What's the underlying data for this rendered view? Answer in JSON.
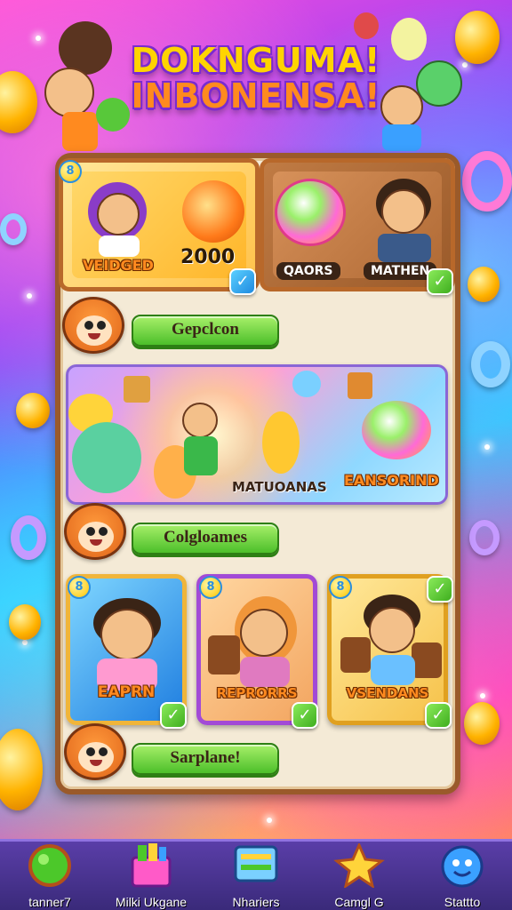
{
  "game": {
    "title_line1": "DOKNGUMA!",
    "title_line2": "INBONENSA!"
  },
  "top_cards": [
    {
      "badge": "8",
      "label": "VEIDGED",
      "value": "2000",
      "check": "✓"
    },
    {
      "label_left": "QAORS",
      "label_right": "MATHEN",
      "check": "✓"
    }
  ],
  "buttons": {
    "first": "Gepclcon",
    "second": "Colgloames",
    "third": "Sarplane!"
  },
  "banner": {
    "label_left": "MATUOANAS",
    "label_right": "EANSORIND"
  },
  "character_cards": [
    {
      "badge": "8",
      "label": "EAPRN",
      "check": "✓"
    },
    {
      "badge": "8",
      "label": "REPRORRS",
      "check": "✓"
    },
    {
      "badge": "8",
      "label": "VSENDANS",
      "check": "✓"
    }
  ],
  "nav": [
    {
      "label": "tanner7",
      "icon": "green-medal-icon"
    },
    {
      "label": "Milki Ukgane",
      "icon": "gift-box-icon"
    },
    {
      "label": "Nhariers",
      "icon": "chat-board-icon"
    },
    {
      "label": "Camgl G",
      "icon": "star-icon"
    },
    {
      "label": "Stattto",
      "icon": "blue-monster-icon"
    }
  ]
}
